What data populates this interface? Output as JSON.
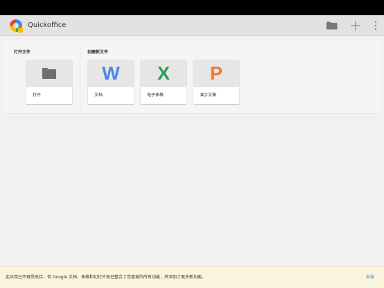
{
  "app": {
    "title": "Quickoffice"
  },
  "sections": {
    "open": {
      "label": "打开文件",
      "tile_label": "打开"
    },
    "create": {
      "label": "创建新文件",
      "tiles": [
        {
          "letter": "W",
          "label": "文档",
          "color": "#4a86e8"
        },
        {
          "letter": "X",
          "label": "电子表格",
          "color": "#2e9e5a"
        },
        {
          "letter": "P",
          "label": "演示文稿",
          "color": "#f07a22"
        }
      ]
    }
  },
  "notice": {
    "message": "此应用已不再受支持，但 Google 文档、表格和幻灯片现已整合了您喜爱的所有功能，并添加了更多新功能。",
    "action_label": "安装"
  },
  "icons": {
    "toolbar": [
      "folder-icon",
      "plus-icon",
      "overflow-menu-icon"
    ]
  }
}
